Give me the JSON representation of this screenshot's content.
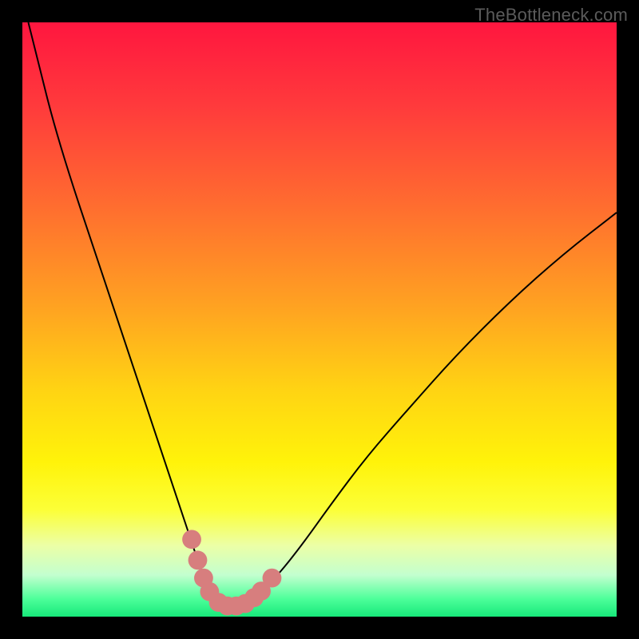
{
  "watermark": "TheBottleneck.com",
  "colors": {
    "frame": "#000000",
    "curve": "#000000",
    "markers": "#d77e7e",
    "gradient_stops": [
      {
        "pct": 0,
        "color": "#ff163f"
      },
      {
        "pct": 14,
        "color": "#ff3a3c"
      },
      {
        "pct": 30,
        "color": "#ff6a30"
      },
      {
        "pct": 48,
        "color": "#ffa321"
      },
      {
        "pct": 62,
        "color": "#ffd413"
      },
      {
        "pct": 74,
        "color": "#fff30a"
      },
      {
        "pct": 82,
        "color": "#fcff37"
      },
      {
        "pct": 88,
        "color": "#ecffa6"
      },
      {
        "pct": 93,
        "color": "#c3ffcf"
      },
      {
        "pct": 97,
        "color": "#4dff9a"
      },
      {
        "pct": 100,
        "color": "#17e87a"
      }
    ]
  },
  "chart_data": {
    "type": "line",
    "title": "",
    "xlabel": "",
    "ylabel": "",
    "xlim": [
      0,
      100
    ],
    "ylim": [
      0,
      100
    ],
    "grid": false,
    "legend": false,
    "series": [
      {
        "name": "bottleneck-curve",
        "x": [
          1,
          3,
          5,
          8,
          12,
          16,
          20,
          23,
          25,
          27,
          29,
          30,
          31,
          32,
          33,
          34,
          35,
          36,
          37,
          38,
          40,
          43,
          47,
          52,
          58,
          65,
          73,
          82,
          91,
          100
        ],
        "y": [
          100,
          92,
          84,
          74,
          62,
          50,
          38,
          29,
          23,
          17,
          11,
          8,
          5.5,
          3.8,
          2.6,
          2.0,
          1.8,
          1.8,
          2.0,
          2.5,
          4.0,
          7.0,
          12,
          19,
          27,
          35,
          44,
          53,
          61,
          68
        ]
      }
    ],
    "markers": [
      {
        "x": 28.5,
        "y": 13.0,
        "r": 1.6
      },
      {
        "x": 29.5,
        "y": 9.5,
        "r": 1.6
      },
      {
        "x": 30.5,
        "y": 6.5,
        "r": 1.6
      },
      {
        "x": 31.5,
        "y": 4.2,
        "r": 1.6
      },
      {
        "x": 33.0,
        "y": 2.4,
        "r": 1.6
      },
      {
        "x": 34.5,
        "y": 1.8,
        "r": 1.6
      },
      {
        "x": 36.0,
        "y": 1.8,
        "r": 1.6
      },
      {
        "x": 37.5,
        "y": 2.2,
        "r": 1.6
      },
      {
        "x": 39.0,
        "y": 3.2,
        "r": 1.6
      },
      {
        "x": 40.2,
        "y": 4.3,
        "r": 1.6
      },
      {
        "x": 42.0,
        "y": 6.5,
        "r": 1.6
      }
    ]
  }
}
